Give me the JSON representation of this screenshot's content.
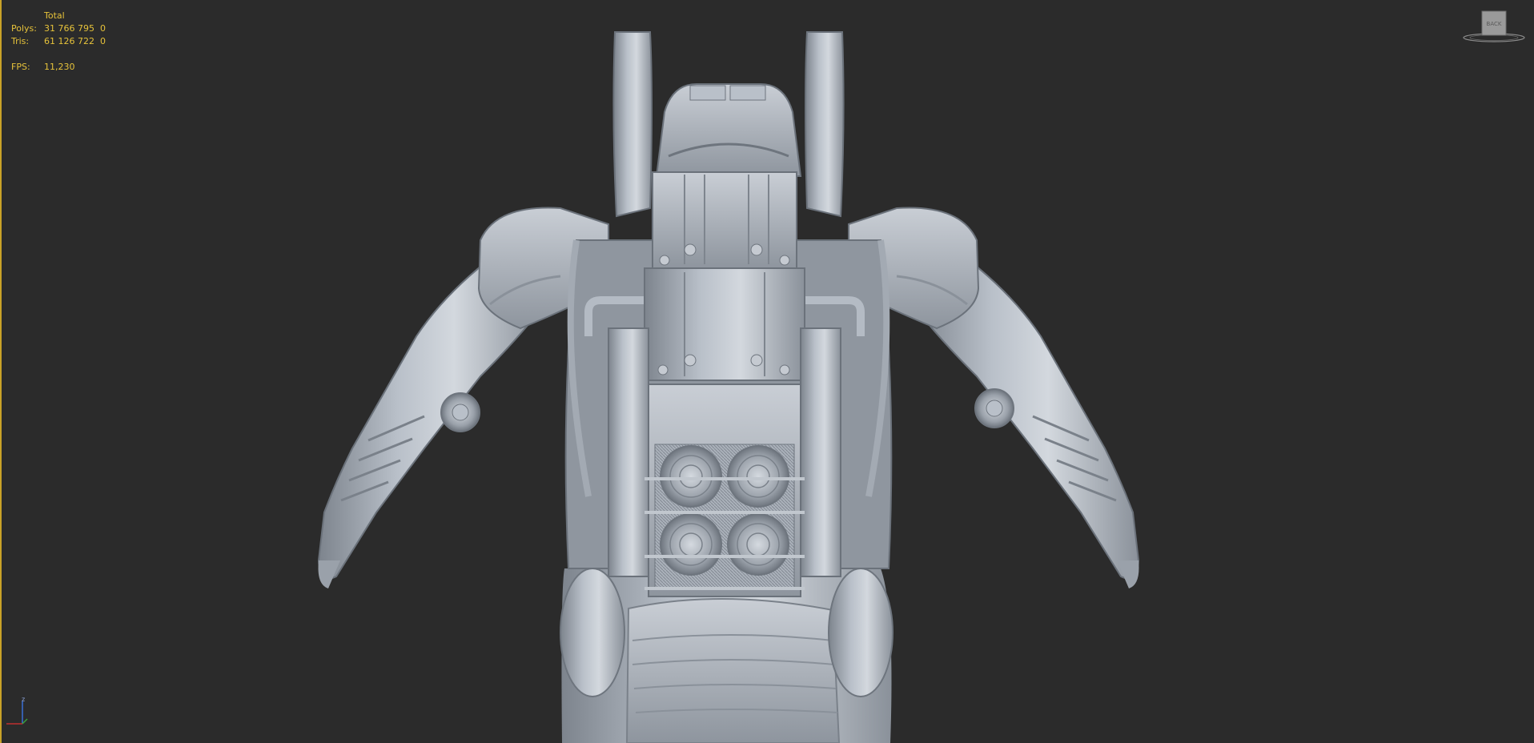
{
  "viewport": {
    "background": "#2b2b2b",
    "active_border_color": "#c9a227",
    "stats_color": "#e6c23a"
  },
  "stats": {
    "header": "Total",
    "polys_label": "Polys:",
    "polys_total": "31 766 795",
    "polys_selected": "0",
    "tris_label": "Tris:",
    "tris_total": "61 126 722",
    "tris_selected": "0",
    "fps_label": "FPS:",
    "fps_value": "11,230"
  },
  "viewcube": {
    "face_label": "BACK",
    "icon": "viewcube-icon"
  },
  "axis_tripod": {
    "z_label": "z",
    "icon": "axis-tripod-icon"
  },
  "model": {
    "description_icon": "power-armor-model",
    "color": "#a9b0ba"
  }
}
